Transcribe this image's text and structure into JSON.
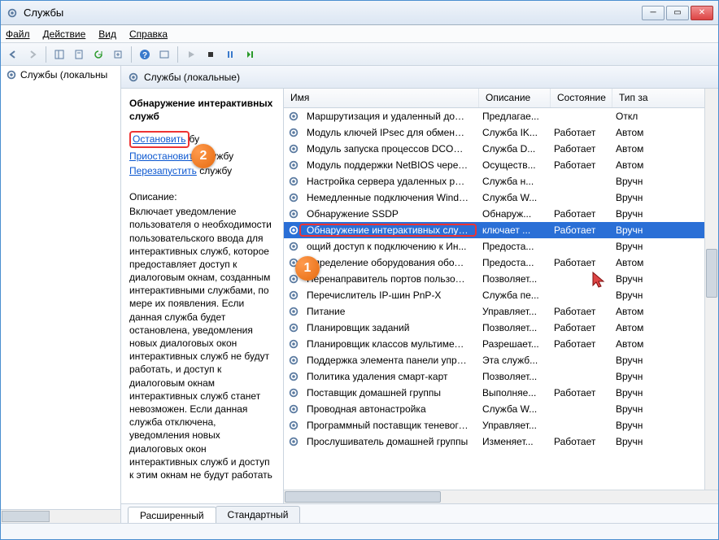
{
  "window": {
    "title": "Службы"
  },
  "menu": {
    "file": "Файл",
    "action": "Действие",
    "view": "Вид",
    "help": "Справка"
  },
  "tree": {
    "root": "Службы (локальны"
  },
  "header": {
    "title": "Службы (локальные)"
  },
  "detail": {
    "service_name": "Обнаружение интерактивных служб",
    "link_stop": "Остановить",
    "link_stop_suffix": "бу",
    "link_pause": "Приостановить",
    "link_pause_suffix": " службу",
    "link_restart": "Перезапустить",
    "link_restart_suffix": " службу",
    "desc_label": "Описание:",
    "desc_text": "Включает уведомление пользователя о необходимости пользовательского ввода для интерактивных служб, которое предоставляет доступ к диалоговым окнам, созданным интерактивными службами, по мере их появления. Если данная служба будет остановлена, уведомления новых диалоговых окон интерактивных служб не будут работать, и доступ к диалоговым окнам интерактивных служб станет невозможен. Если данная служба отключена, уведомления новых диалоговых окон интерактивных служб и доступ к этим окнам не будут работать"
  },
  "columns": {
    "name": "Имя",
    "desc": "Описание",
    "state": "Состояние",
    "type": "Тип за"
  },
  "services": [
    {
      "name": "Маршрутизация и удаленный доступ",
      "desc": "Предлагае...",
      "state": "",
      "type": "Откл"
    },
    {
      "name": "Модуль ключей IPsec для обмена к...",
      "desc": "Служба IK...",
      "state": "Работает",
      "type": "Автом"
    },
    {
      "name": "Модуль запуска процессов DCOM-с...",
      "desc": "Служба D...",
      "state": "Работает",
      "type": "Автом"
    },
    {
      "name": "Модуль поддержки NetBIOS через T...",
      "desc": "Осуществ...",
      "state": "Работает",
      "type": "Автом"
    },
    {
      "name": "Настройка сервера удаленных раб...",
      "desc": "Служба н...",
      "state": "",
      "type": "Вручн"
    },
    {
      "name": "Немедленные подключения Windo...",
      "desc": "Служба W...",
      "state": "",
      "type": "Вручн"
    },
    {
      "name": "Обнаружение SSDP",
      "desc": "Обнаруж...",
      "state": "Работает",
      "type": "Вручн"
    },
    {
      "name": "Обнаружение интерактивных служб",
      "desc": "ключает ...",
      "state": "Работает",
      "type": "Вручн",
      "selected": true
    },
    {
      "name": "ощий доступ к подключению к Ин...",
      "desc": "Предоста...",
      "state": "",
      "type": "Вручн"
    },
    {
      "name": "Определение оборудования оболоч...",
      "desc": "Предоста...",
      "state": "Работает",
      "type": "Автом"
    },
    {
      "name": "Перенаправитель портов пользоват...",
      "desc": "Позволяет...",
      "state": "",
      "type": "Вручн"
    },
    {
      "name": "Перечислитель IP-шин PnP-X",
      "desc": "Служба пе...",
      "state": "",
      "type": "Вручн"
    },
    {
      "name": "Питание",
      "desc": "Управляет...",
      "state": "Работает",
      "type": "Автом"
    },
    {
      "name": "Планировщик заданий",
      "desc": "Позволяет...",
      "state": "Работает",
      "type": "Автом"
    },
    {
      "name": "Планировщик классов мультимедиа",
      "desc": "Разрешает...",
      "state": "Работает",
      "type": "Автом"
    },
    {
      "name": "Поддержка элемента панели управл...",
      "desc": "Эта служб...",
      "state": "",
      "type": "Вручн"
    },
    {
      "name": "Политика удаления смарт-карт",
      "desc": "Позволяет...",
      "state": "",
      "type": "Вручн"
    },
    {
      "name": "Поставщик домашней группы",
      "desc": "Выполняе...",
      "state": "Работает",
      "type": "Вручн"
    },
    {
      "name": "Проводная автонастройка",
      "desc": "Служба W...",
      "state": "",
      "type": "Вручн"
    },
    {
      "name": "Программный поставщик теневого ...",
      "desc": "Управляет...",
      "state": "",
      "type": "Вручн"
    },
    {
      "name": "Прослушиватель домашней группы",
      "desc": "Изменяет...",
      "state": "Работает",
      "type": "Вручн"
    }
  ],
  "tabs": {
    "extended": "Расширенный",
    "standard": "Стандартный"
  },
  "badges": {
    "b1": "1",
    "b2": "2"
  }
}
